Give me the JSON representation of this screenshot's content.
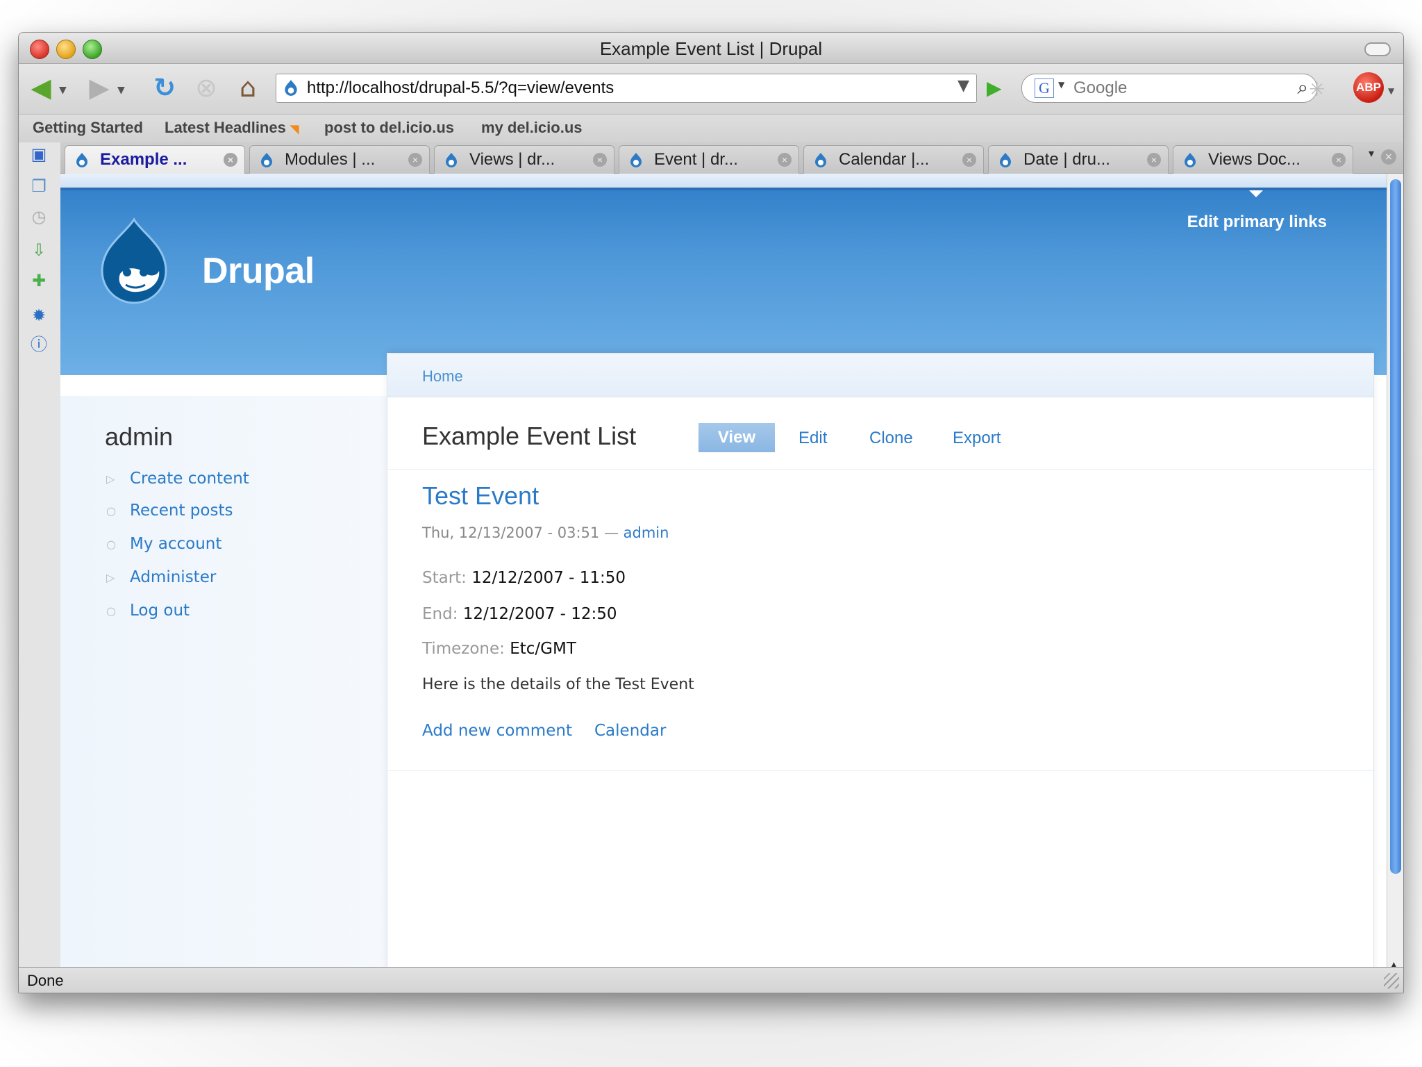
{
  "window": {
    "title": "Example Event List | Drupal"
  },
  "toolbar": {
    "url": "http://localhost/drupal-5.5/?q=view/events",
    "search_placeholder": "Google",
    "adblock_label": "ABP"
  },
  "bookmarks": [
    "Getting Started",
    "Latest Headlines",
    "post to del.icio.us",
    "my del.icio.us"
  ],
  "tabs": [
    {
      "label": "Example ...",
      "active": true
    },
    {
      "label": "Modules | ..."
    },
    {
      "label": "Views | dr..."
    },
    {
      "label": "Event | dr..."
    },
    {
      "label": "Calendar |..."
    },
    {
      "label": "Date | dru..."
    },
    {
      "label": "Views Doc..."
    }
  ],
  "site": {
    "name": "Drupal",
    "edit_primary_links": "Edit primary links"
  },
  "sidebar": {
    "title": "admin",
    "links": [
      "Create content",
      "Recent posts",
      "My account",
      "Administer",
      "Log out"
    ]
  },
  "page": {
    "breadcrumb": "Home",
    "title": "Example Event List",
    "tabs": [
      "View",
      "Edit",
      "Clone",
      "Export"
    ]
  },
  "node": {
    "title": "Test Event",
    "submitted_date": "Thu, 12/13/2007 - 03:51 — ",
    "author": "admin",
    "start_label": "Start:",
    "start_value": "12/12/2007 - 11:50",
    "end_label": "End:",
    "end_value": "12/12/2007 - 12:50",
    "timezone_label": "Timezone:",
    "timezone_value": "Etc/GMT",
    "body": "Here is the details of the Test Event",
    "links": [
      "Add new comment",
      "Calendar"
    ]
  },
  "status": {
    "text": "Done"
  },
  "colors": {
    "accent": "#2a7ac8",
    "header_blue": "#4d97d8"
  }
}
